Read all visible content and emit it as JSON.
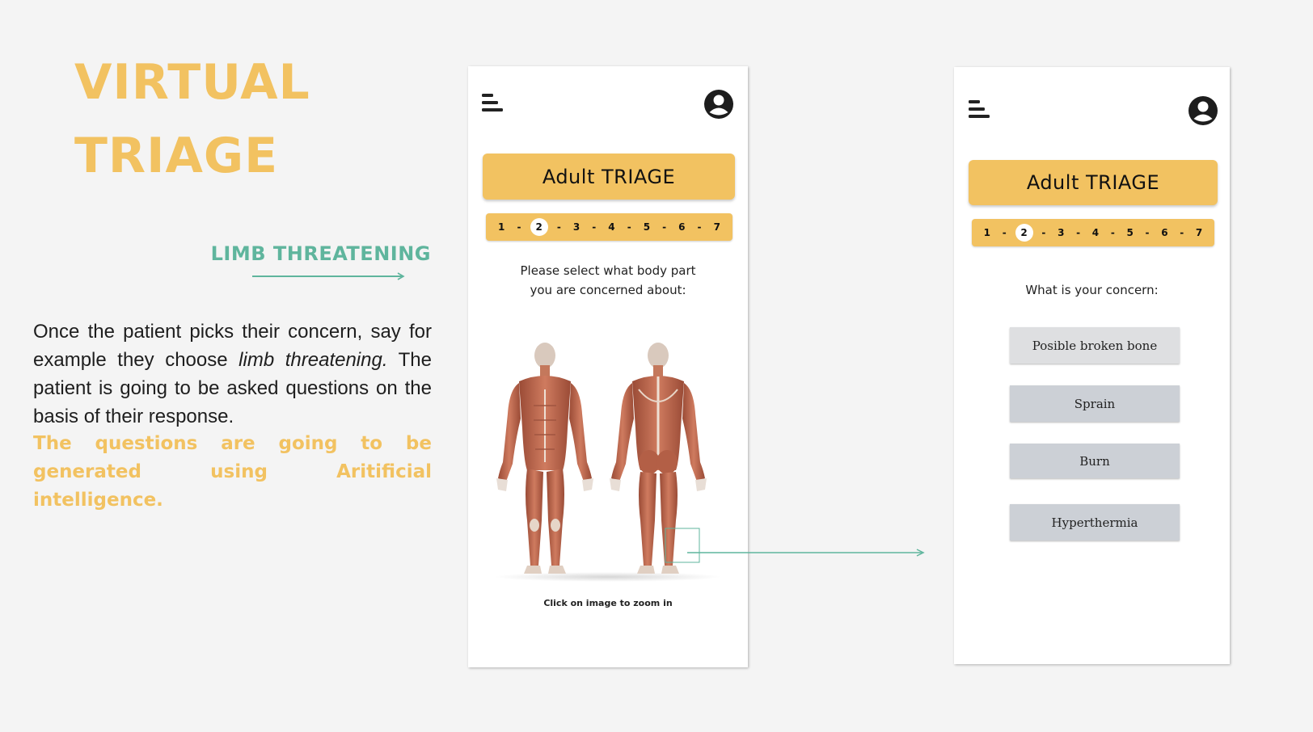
{
  "slide": {
    "title_line1": "VIRTUAL",
    "title_line2": "TRIAGE",
    "section_label": "LIMB THREATENING",
    "description_before": "Once the patient picks their concern, say for example they choose ",
    "description_emphasis": "limb threatening.",
    "description_after": " The patient is going to be asked questions on the basis of their response.",
    "highlight": "The questions are going to be generated using Aritificial intelligence.",
    "accent_color": "#f2c261",
    "teal_color": "#5fb59d"
  },
  "phone1": {
    "menu_icon": "hamburger-menu-icon",
    "user_icon": "user-account-icon",
    "banner_title": "Adult TRIAGE",
    "steps": [
      "1",
      "2",
      "3",
      "4",
      "5",
      "6",
      "7"
    ],
    "active_step": "2",
    "prompt_line1": "Please select what body part",
    "prompt_line2": "you are concerned about:",
    "body_image": "anatomy-front-back-figures",
    "zoom_hint": "Click on image to zoom in"
  },
  "phone2": {
    "menu_icon": "hamburger-menu-icon",
    "user_icon": "user-account-icon",
    "banner_title": "Adult TRIAGE",
    "steps": [
      "1",
      "2",
      "3",
      "4",
      "5",
      "6",
      "7"
    ],
    "active_step": "2",
    "prompt": "What is your concern:",
    "options": [
      "Posible broken bone",
      "Sprain",
      "Burn",
      "Hyperthermia"
    ]
  }
}
